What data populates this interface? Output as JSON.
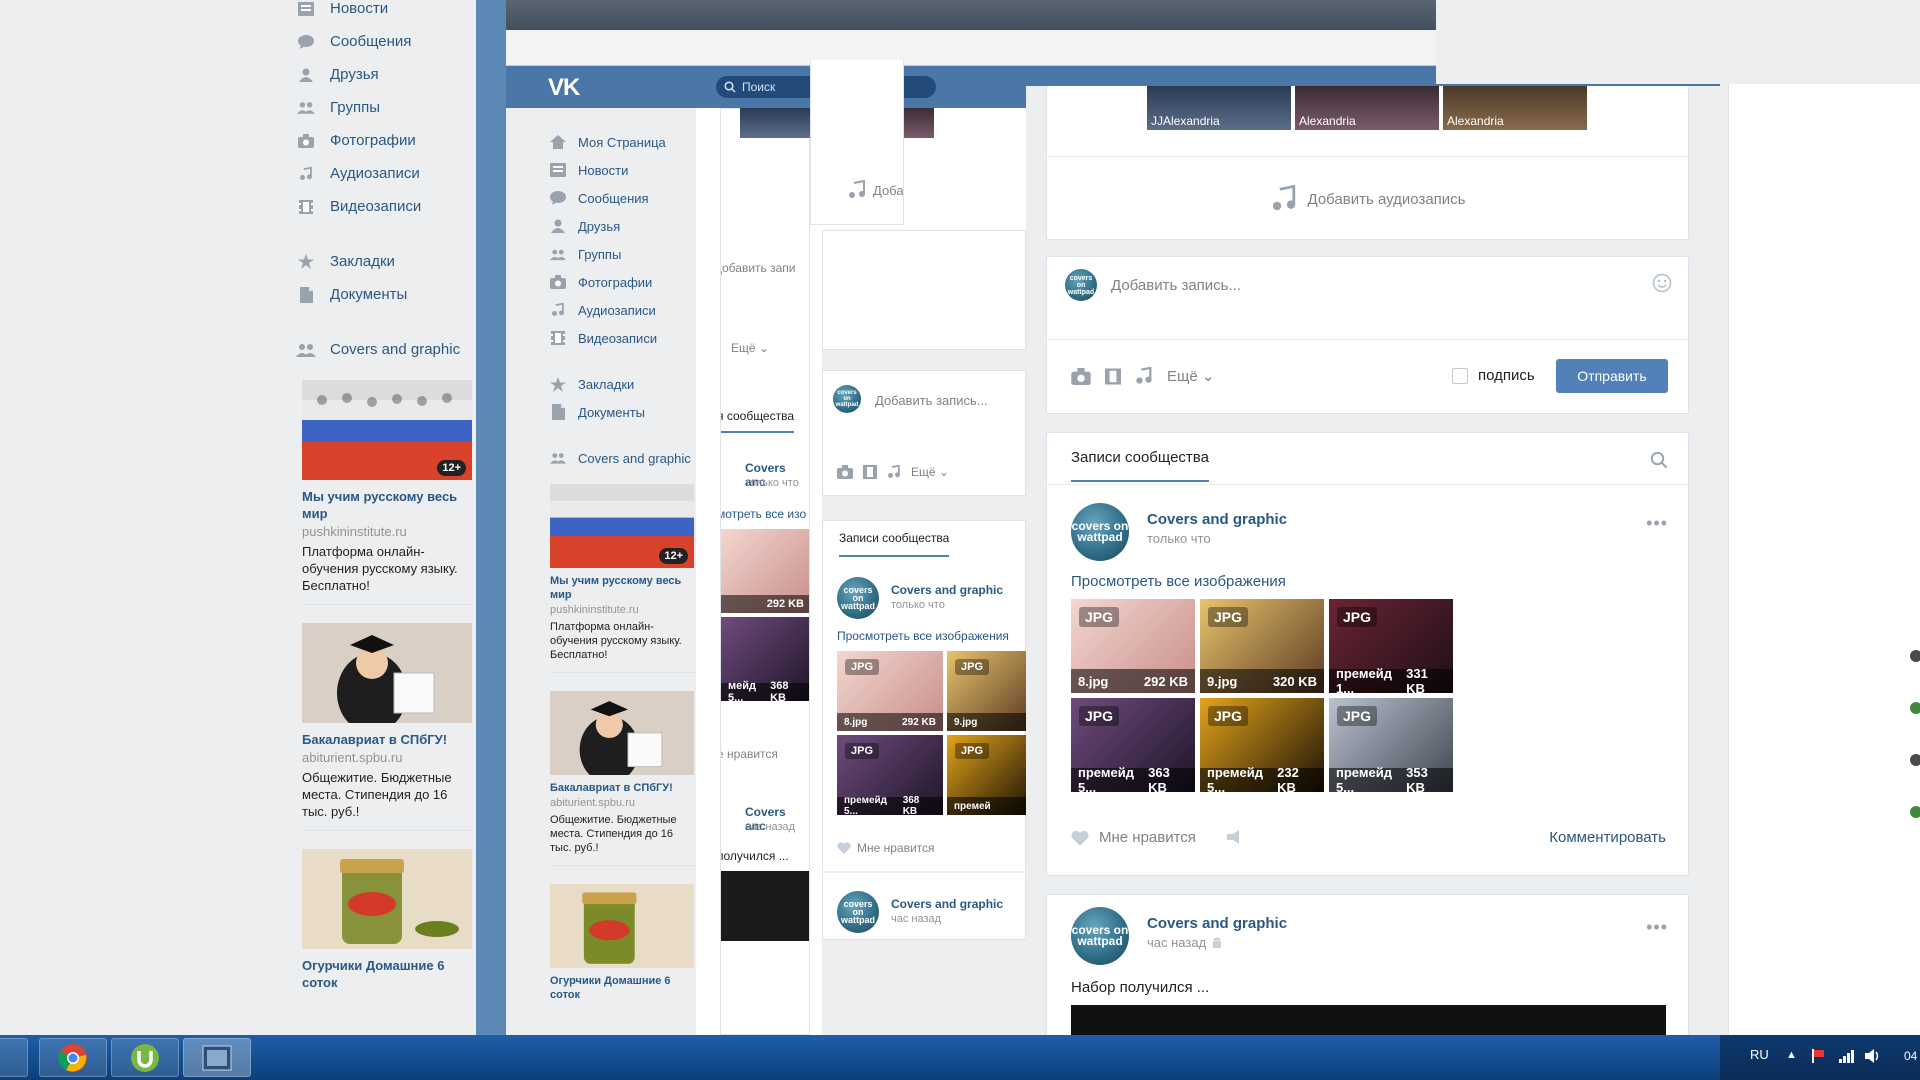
{
  "left_window": {
    "nav": [
      {
        "label": "Новости",
        "icon": "news-icon"
      },
      {
        "label": "Сообщения",
        "icon": "messages-icon"
      },
      {
        "label": "Друзья",
        "icon": "friends-icon"
      },
      {
        "label": "Группы",
        "icon": "groups-icon"
      },
      {
        "label": "Фотографии",
        "icon": "camera-icon"
      },
      {
        "label": "Аудиозаписи",
        "icon": "music-icon"
      },
      {
        "label": "Видеозаписи",
        "icon": "video-icon"
      }
    ],
    "nav2": [
      {
        "label": "Закладки",
        "icon": "star-icon"
      },
      {
        "label": "Документы",
        "icon": "document-icon"
      }
    ],
    "group": {
      "label": "Covers and graphic",
      "icon": "groups-icon"
    },
    "ads": [
      {
        "title": "Мы учим русскому весь мир",
        "domain": "pushkininstitute.ru",
        "desc": "Платформа онлайн-обучения русскому языку. Бесплатно!",
        "age": "12+"
      },
      {
        "title": "Бакалавриат в СПбГУ!",
        "domain": "abiturient.spbu.ru",
        "desc": "Общежитие. Бюджетные места. Стипендия до 16 тыс. руб.!"
      },
      {
        "title": "Огурчики Домашние 6 соток",
        "domain": "",
        "desc": ""
      }
    ]
  },
  "mid_window": {
    "logo": "VK",
    "search_placeholder": "Поиск",
    "nav": [
      {
        "label": "Моя Страница",
        "icon": "home-icon"
      },
      {
        "label": "Новости",
        "icon": "news-icon"
      },
      {
        "label": "Сообщения",
        "icon": "messages-icon"
      },
      {
        "label": "Друзья",
        "icon": "friends-icon"
      },
      {
        "label": "Группы",
        "icon": "groups-icon"
      },
      {
        "label": "Фотографии",
        "icon": "camera-icon"
      },
      {
        "label": "Аудиозаписи",
        "icon": "music-icon"
      },
      {
        "label": "Видеозаписи",
        "icon": "video-icon"
      }
    ],
    "nav2": [
      {
        "label": "Закладки",
        "icon": "star-icon"
      },
      {
        "label": "Документы",
        "icon": "document-icon"
      }
    ],
    "group": "Covers and graphic",
    "ads": [
      {
        "title": "Мы учим русскому весь мир",
        "domain": "pushkininstitute.ru",
        "desc": "Платформа онлайн-обучения русскому языку. Бесплатно!",
        "age": "12+"
      },
      {
        "title": "Бакалавриат в СПбГУ!",
        "domain": "abiturient.spbu.ru",
        "desc": "Общежитие. Бюджетные места. Стипендия до 16 тыс. руб.!"
      },
      {
        "title": "Огурчики Домашние 6 соток"
      }
    ],
    "frag": {
      "add_short": "Доба",
      "add_record_short": "добавить запи",
      "more": "Ещё",
      "community_short": "я сообщества",
      "covers_short": "Covers anc",
      "time_short": "только что",
      "view_short": "мотреть все изо",
      "size1": "292 KB",
      "size2": "368 KB",
      "premade": "мейд 5...",
      "likes_short": "е нравится",
      "covers_short2": "Covers anc",
      "hour_short": "час назад",
      "received_short": "получился ..."
    },
    "feed": {
      "add_record": "Добавить запись...",
      "more": "Ещё",
      "tab": "Записи сообщества",
      "author": "Covers and graphic",
      "time": "только что",
      "view_all": "Просмотреть все изображения",
      "photos": [
        {
          "tag": "JPG",
          "name": "8.jpg",
          "size": "292 KB"
        },
        {
          "tag": "JPG",
          "name": "9.jpg",
          "size": ""
        },
        {
          "tag": "JPG",
          "name": "премейд 5...",
          "size": "368 KB"
        },
        {
          "tag": "JPG",
          "name": "премей",
          "size": ""
        }
      ],
      "likes": "Мне нравится",
      "author2": "Covers and graphic",
      "time2": "час назад"
    }
  },
  "main": {
    "strip_captions": [
      "JJAlexandria",
      "Alexandria",
      "Alexandria"
    ],
    "add_audio": "Добавить аудиозапись",
    "add_record_placeholder": "Добавить запись...",
    "more": "Ещё",
    "signature": "подпись",
    "send": "Отправить",
    "tab": "Записи сообщества",
    "post1": {
      "author": "Covers and graphic",
      "time": "только что",
      "view_all": "Просмотреть все изображения",
      "photos": [
        {
          "tag": "JPG",
          "name": "8.jpg",
          "size": "292 KB",
          "c1": "#f3d7d0",
          "c2": "#c98d8a"
        },
        {
          "tag": "JPG",
          "name": "9.jpg",
          "size": "320 KB",
          "c1": "#e7c46a",
          "c2": "#5d3a26"
        },
        {
          "tag": "JPG",
          "name": "премейд 1...",
          "size": "331 KB",
          "c1": "#6a2435",
          "c2": "#1e0f16"
        },
        {
          "tag": "JPG",
          "name": "премейд 5...",
          "size": "363 KB",
          "c1": "#6f4b7d",
          "c2": "#1e1528"
        },
        {
          "tag": "JPG",
          "name": "премейд 5...",
          "size": "232 KB",
          "c1": "#e3a31b",
          "c2": "#1d1306"
        },
        {
          "tag": "JPG",
          "name": "премейд 5...",
          "size": "353 KB",
          "c1": "#b9c2cf",
          "c2": "#3f4652"
        }
      ],
      "likes": "Мне нравится",
      "comment": "Комментировать"
    },
    "post2": {
      "author": "Covers and graphic",
      "time": "час назад",
      "text": "Набор получился ..."
    },
    "avatar_text": "covers on wattpad"
  },
  "taskbar": {
    "lang": "RU",
    "clock_partial": "04"
  },
  "colors": {
    "vk_blue": "#4a76a8",
    "link": "#2a5885",
    "button": "#5181b8",
    "bg": "#edeef0"
  }
}
